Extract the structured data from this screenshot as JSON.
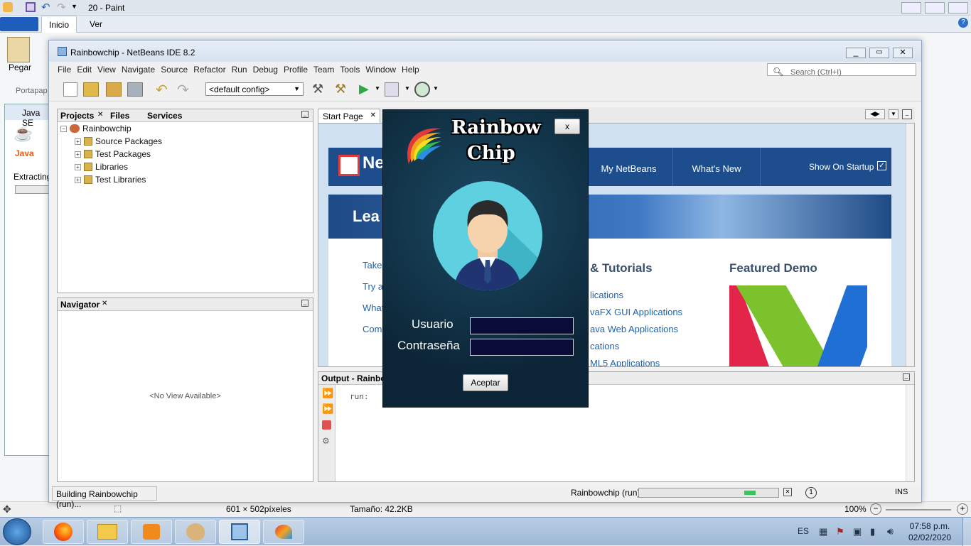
{
  "paint": {
    "title": "20 - Paint",
    "tabs": [
      "Inicio",
      "Ver"
    ],
    "paste_label": "Pegar",
    "clipboard_group": "Portapap",
    "status_dimensions": "601 × 502píxeles",
    "status_size": "Tamaño: 42.2KB",
    "zoom": "100%"
  },
  "java_installer": {
    "title": "Java SE",
    "logo_text": "Java",
    "status": "Extracting"
  },
  "netbeans": {
    "title": "Rainbowchip - NetBeans IDE 8.2",
    "menu": [
      "File",
      "Edit",
      "View",
      "Navigate",
      "Source",
      "Refactor",
      "Run",
      "Debug",
      "Profile",
      "Team",
      "Tools",
      "Window",
      "Help"
    ],
    "search_placeholder": "Search (Ctrl+I)",
    "config": "<default config>",
    "projects_tabs": [
      "Projects",
      "Files",
      "Services"
    ],
    "project_root": "Rainbowchip",
    "tree": [
      "Source Packages",
      "Test Packages",
      "Libraries",
      "Test Libraries"
    ],
    "navigator_title": "Navigator",
    "navigator_empty": "<No View Available>",
    "editor_tab": "Start Page",
    "start_page": {
      "nav": [
        "My NetBeans",
        "What's New"
      ],
      "show_on_startup": "Show On Startup",
      "brand": "Net",
      "banner": "Lea",
      "left_links": [
        "Take",
        "Try a",
        "What'",
        "Comm"
      ],
      "tutorials_heading": "& Tutorials",
      "tutorial_links": [
        "lications",
        "vaFX GUI Applications",
        "ava Web Applications",
        "cations",
        "ML5 Applications"
      ],
      "featured_heading": "Featured Demo"
    },
    "output_title": "Output - Rainbow",
    "output_text": "run:",
    "status_left": "Building Rainbowchip (run)...",
    "status_task": "Rainbowchip (run)",
    "status_ins": "INS",
    "status_badge": "1"
  },
  "dialog": {
    "logo_line1": "Rainbow",
    "logo_line2": "Chip",
    "close_label": "x",
    "user_label": "Usuario",
    "password_label": "Contraseña",
    "user_value": "",
    "password_value": "",
    "submit_label": "Aceptar"
  },
  "taskbar": {
    "language": "ES",
    "time": "07:58 p.m.",
    "date": "02/02/2020"
  },
  "colors": {
    "netbeans_blue": "#1d4d8c",
    "dialog_bg": "#0c2536",
    "field_bg": "#0a0c38",
    "avatar_circle": "#5ed0e0"
  }
}
